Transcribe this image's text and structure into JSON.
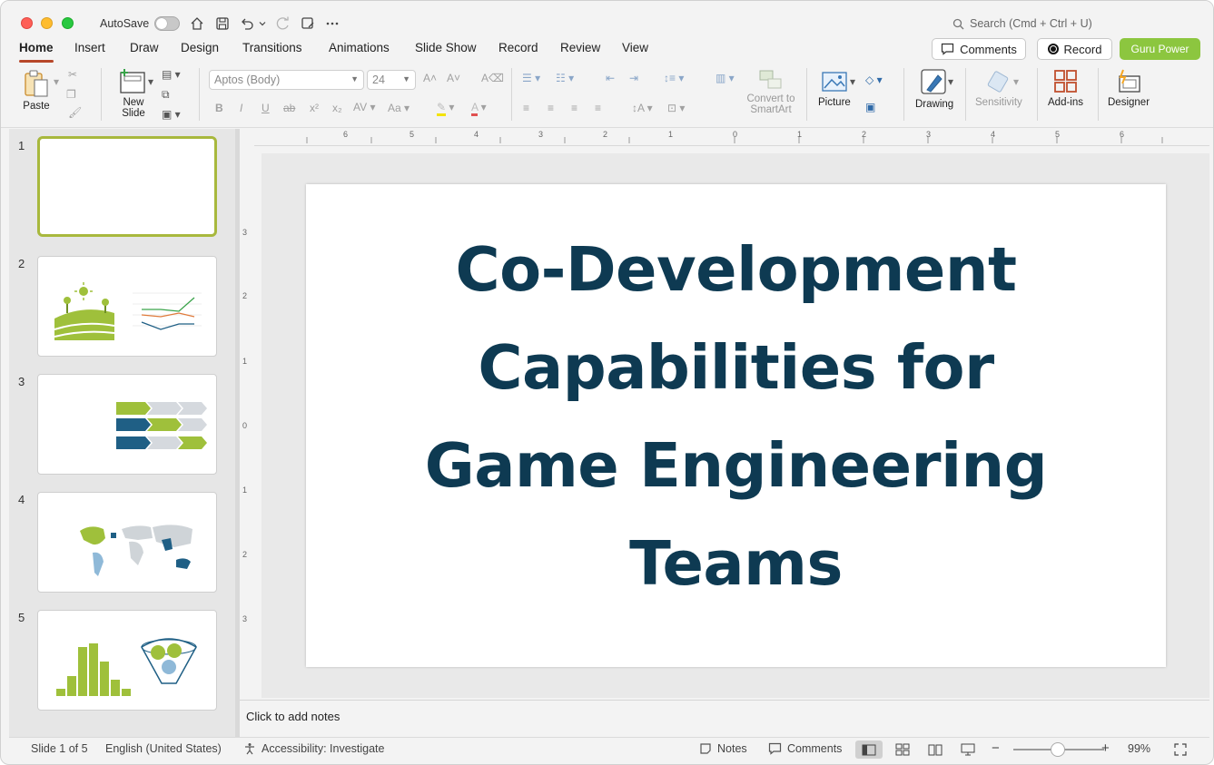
{
  "window": {
    "autosave_label": "AutoSave",
    "search_placeholder": "Search (Cmd + Ctrl + U)"
  },
  "tabs": [
    "Home",
    "Insert",
    "Draw",
    "Design",
    "Transitions",
    "Animations",
    "Slide Show",
    "Record",
    "Review",
    "View"
  ],
  "header_buttons": {
    "comments": "Comments",
    "record": "Record",
    "guru": "Guru Power"
  },
  "colors": {
    "accent_green": "#8cc63f",
    "title_navy": "#0e3a52",
    "thumb_green": "#9fc03b",
    "thumb_blue": "#1f5f85"
  },
  "ribbon": {
    "paste": "Paste",
    "new_slide": "New Slide",
    "font_name": "Aptos (Body)",
    "font_size": "24",
    "convert_smartart": "Convert to SmartArt",
    "picture": "Picture",
    "drawing": "Drawing",
    "sensitivity": "Sensitivity",
    "addins": "Add-ins",
    "designer": "Designer"
  },
  "thumbnails": [
    {
      "num": "1"
    },
    {
      "num": "2"
    },
    {
      "num": "3"
    },
    {
      "num": "4"
    },
    {
      "num": "5"
    }
  ],
  "slide": {
    "title_lines": [
      "Co-Development",
      "Capabilities for",
      "Game Engineering",
      "Teams"
    ]
  },
  "ruler": {
    "top_ticks": [
      "6",
      "5",
      "4",
      "3",
      "2",
      "1",
      "0",
      "1",
      "2",
      "3",
      "4",
      "5",
      "6"
    ],
    "left_ticks": [
      "3",
      "2",
      "1",
      "0",
      "1",
      "2",
      "3"
    ]
  },
  "notes": {
    "placeholder": "Click to add notes"
  },
  "status": {
    "slide_count": "Slide 1 of 5",
    "language": "English (United States)",
    "accessibility": "Accessibility: Investigate",
    "notes": "Notes",
    "comments": "Comments",
    "zoom": "99%"
  }
}
